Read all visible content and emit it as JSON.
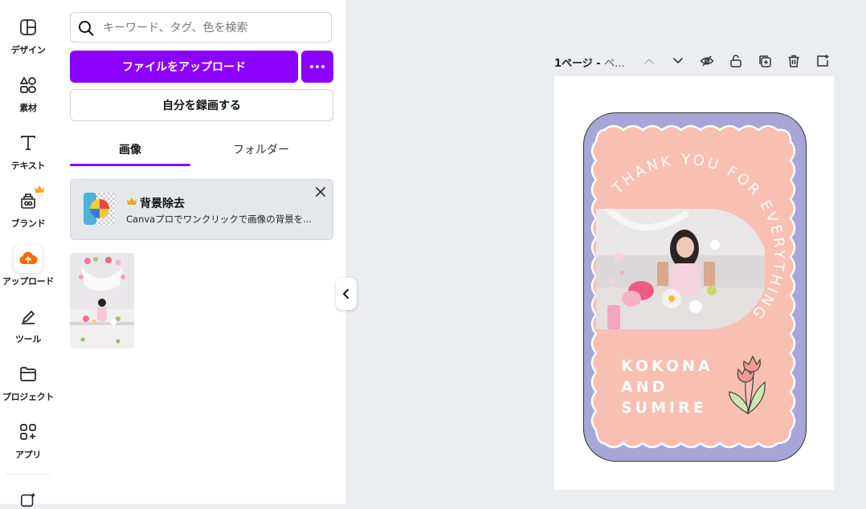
{
  "sidebar": {
    "items": [
      {
        "label": "デザイン",
        "icon": "layout-icon"
      },
      {
        "label": "素材",
        "icon": "shapes-icon"
      },
      {
        "label": "テキスト",
        "icon": "text-icon"
      },
      {
        "label": "ブランド",
        "icon": "brand-icon",
        "premium": true
      },
      {
        "label": "アップロード",
        "icon": "cloud-upload-icon",
        "active": true
      },
      {
        "label": "ツール",
        "icon": "pen-tool-icon"
      },
      {
        "label": "プロジェクト",
        "icon": "folder-icon"
      },
      {
        "label": "アプリ",
        "icon": "apps-icon"
      }
    ]
  },
  "panel": {
    "search_placeholder": "キーワード、タグ、色を検索",
    "upload_button": "ファイルをアップロード",
    "record_button": "自分を録画する",
    "tabs": [
      {
        "label": "画像",
        "active": true
      },
      {
        "label": "フォルダー",
        "active": false
      }
    ],
    "promo": {
      "title": "背景除去",
      "description": "Canvaプロでワンクリックで画像の背景を..."
    }
  },
  "editor": {
    "page_label": "1ページ - ",
    "page_label_rest": "ペ..."
  },
  "design": {
    "headline": "THANK YOU FOR EVERYTHING.",
    "names": [
      "KOKONA",
      "AND",
      "SUMIRE"
    ]
  },
  "colors": {
    "accent": "#8b00ff",
    "card_border": "#a8a6d8",
    "card_fill": "#f8bfb3",
    "upload_icon": "#ff6a00",
    "crown": "#f5a623"
  }
}
